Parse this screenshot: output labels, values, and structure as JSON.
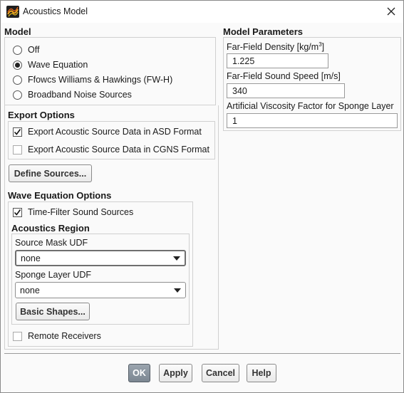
{
  "window": {
    "title": "Acoustics Model"
  },
  "model": {
    "heading": "Model",
    "options": [
      {
        "label": "Off",
        "selected": false
      },
      {
        "label": "Wave Equation",
        "selected": true
      },
      {
        "label": "Ffowcs Williams & Hawkings (FW-H)",
        "selected": false
      },
      {
        "label": "Broadband Noise Sources",
        "selected": false
      }
    ]
  },
  "export_options": {
    "heading": "Export Options",
    "asd": {
      "label": "Export Acoustic Source Data in ASD Format",
      "checked": true
    },
    "cgns": {
      "label": "Export Acoustic Source Data in CGNS Format",
      "checked": false
    }
  },
  "define_sources_label": "Define Sources...",
  "wave_options": {
    "heading": "Wave Equation Options",
    "time_filter": {
      "label": "Time-Filter Sound Sources",
      "checked": true
    },
    "region_heading": "Acoustics Region",
    "source_mask": {
      "label": "Source Mask UDF",
      "value": "none"
    },
    "sponge_layer": {
      "label": "Sponge Layer UDF",
      "value": "none"
    },
    "basic_shapes_label": "Basic Shapes...",
    "remote_receivers": {
      "label": "Remote Receivers",
      "checked": false
    }
  },
  "model_parameters": {
    "heading": "Model Parameters",
    "density": {
      "label_prefix": "Far-Field Density [kg/m",
      "label_sup": "3",
      "label_suffix": "]",
      "value": "1.225"
    },
    "sound_speed": {
      "label": "Far-Field Sound Speed [m/s]",
      "value": "340"
    },
    "viscosity": {
      "label": "Artificial Viscosity Factor for Sponge Layer",
      "value": "1"
    }
  },
  "buttons": {
    "ok": "OK",
    "apply": "Apply",
    "cancel": "Cancel",
    "help": "Help"
  },
  "icons": {
    "app": "acoustics-app-icon",
    "close": "close-icon",
    "check": "checkmark-icon",
    "dropdown": "chevron-down-icon"
  }
}
